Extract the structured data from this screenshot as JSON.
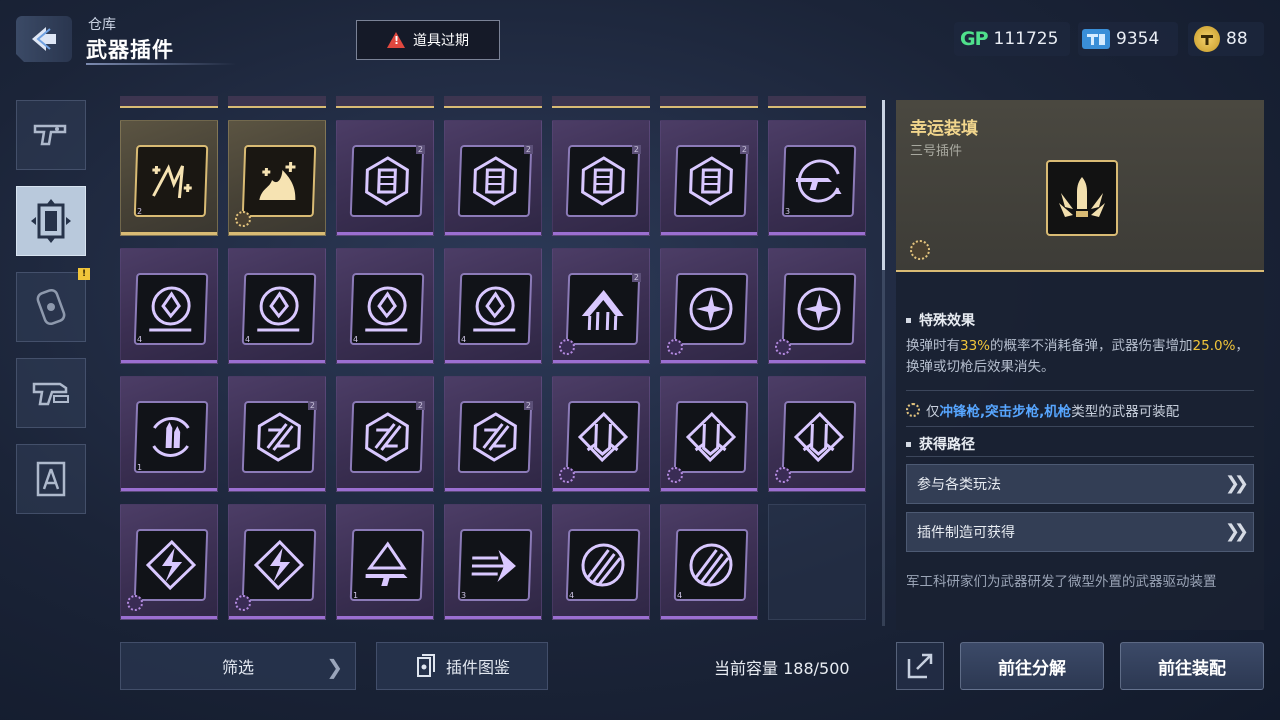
{
  "header": {
    "breadcrumb": "仓库",
    "title": "武器插件",
    "alert_label": "道具过期"
  },
  "currencies": {
    "gp": {
      "logo": "GP",
      "amount": "111725"
    },
    "ticket": {
      "amount": "9354"
    },
    "coin": {
      "amount": "88"
    }
  },
  "sidebar": {
    "tabs": [
      {
        "icon": "pistol-icon",
        "active": false
      },
      {
        "icon": "plugin-chip-icon",
        "active": true
      },
      {
        "icon": "attachment-icon",
        "active": false,
        "badge": "!"
      },
      {
        "icon": "rifle-parts-icon",
        "active": false
      },
      {
        "icon": "blueprint-icon",
        "active": false
      }
    ]
  },
  "grid": {
    "columns": 7,
    "items": [
      {
        "rarity": "gold",
        "icon": "spark-arrow-icon",
        "tier": "2"
      },
      {
        "rarity": "gold",
        "icon": "flame-burst-icon",
        "gear": true
      },
      {
        "rarity": "purple",
        "icon": "hex-magazine-icon",
        "level": "2"
      },
      {
        "rarity": "purple",
        "icon": "hex-magazine-icon",
        "level": "2"
      },
      {
        "rarity": "purple",
        "icon": "hex-magazine-icon",
        "level": "2"
      },
      {
        "rarity": "purple",
        "icon": "hex-magazine-icon",
        "level": "2"
      },
      {
        "rarity": "purple",
        "icon": "rifle-reload-icon",
        "tier": "3"
      },
      {
        "rarity": "purple",
        "icon": "drop-ring-icon",
        "tier": "4"
      },
      {
        "rarity": "purple",
        "icon": "drop-ring-icon",
        "tier": "4"
      },
      {
        "rarity": "purple",
        "icon": "drop-ring-icon",
        "tier": "4"
      },
      {
        "rarity": "purple",
        "icon": "drop-ring-icon",
        "tier": "4"
      },
      {
        "rarity": "purple",
        "icon": "arrow-up-crown-icon",
        "level": "2",
        "gear": true
      },
      {
        "rarity": "purple",
        "icon": "star-ring-icon",
        "gear": true
      },
      {
        "rarity": "purple",
        "icon": "star-ring-icon",
        "gear": true
      },
      {
        "rarity": "purple",
        "icon": "bullet-cycle-icon",
        "tier": "1"
      },
      {
        "rarity": "purple",
        "icon": "hex-slash-icon",
        "level": "2"
      },
      {
        "rarity": "purple",
        "icon": "hex-slash-icon",
        "level": "2"
      },
      {
        "rarity": "purple",
        "icon": "hex-slash-icon",
        "level": "2"
      },
      {
        "rarity": "purple",
        "icon": "diamond-drop-icon",
        "gear": true
      },
      {
        "rarity": "purple",
        "icon": "diamond-drop-icon",
        "gear": true
      },
      {
        "rarity": "purple",
        "icon": "diamond-drop-icon",
        "gear": true
      },
      {
        "rarity": "purple",
        "icon": "lightning-diamond-icon",
        "gear": true
      },
      {
        "rarity": "purple",
        "icon": "lightning-diamond-icon",
        "gear": true
      },
      {
        "rarity": "purple",
        "icon": "weapon-arrow-icon",
        "tier": "1"
      },
      {
        "rarity": "purple",
        "icon": "speed-arrows-icon",
        "tier": "3"
      },
      {
        "rarity": "purple",
        "icon": "claw-orb-icon",
        "tier": "4"
      },
      {
        "rarity": "purple",
        "icon": "claw-orb-icon",
        "tier": "4"
      },
      {
        "rarity": "empty"
      }
    ]
  },
  "bottom": {
    "filter_label": "筛选",
    "codex_label": "插件图鉴",
    "capacity": "当前容量 188/500",
    "dismantle_label": "前往分解",
    "equip_label": "前往装配"
  },
  "detail": {
    "name": "幸运装填",
    "subtitle": "三号插件",
    "icon": "bullet-wings-icon",
    "tier": "3",
    "effect_title": "特殊效果",
    "effect_pre": "换弹时有",
    "effect_pct1": "33%",
    "effect_mid": "的概率不消耗备弹，武器伤害增加",
    "effect_pct2": "25.0%",
    "effect_post": "，换弹或切枪后效果消失。",
    "equip_pre": "仅",
    "equip_types": [
      "冲锋枪",
      "突击步枪",
      "机枪"
    ],
    "equip_sep": ",",
    "equip_post": "类型的武器可装配",
    "source_title": "获得路径",
    "sources": [
      "参与各类玩法",
      "插件制造可获得"
    ],
    "lore": "军工科研家们为武器研发了微型外置的武器驱动装置"
  },
  "colors": {
    "gold": "#d9bb74",
    "purple": "#9b6fd1",
    "highlight": "#f1c53a",
    "weapon_type": "#57a6ff",
    "gp_green": "#4fe08c"
  }
}
